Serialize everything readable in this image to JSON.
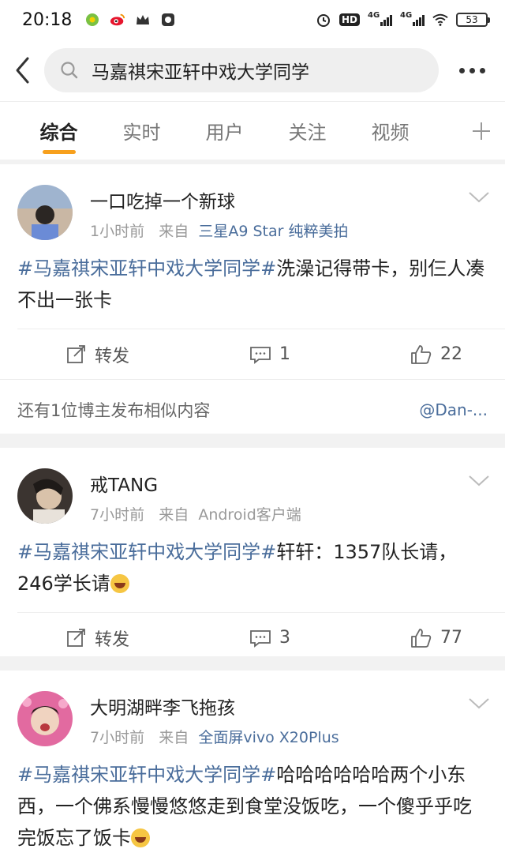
{
  "status_bar": {
    "time": "20:18",
    "battery": "53",
    "network_1": "4G",
    "network_2": "4G",
    "hd_label": "HD"
  },
  "search": {
    "query": "马嘉祺宋亚轩中戏大学同学"
  },
  "tabs": [
    {
      "label": "综合",
      "active": true
    },
    {
      "label": "实时",
      "active": false
    },
    {
      "label": "用户",
      "active": false
    },
    {
      "label": "关注",
      "active": false
    },
    {
      "label": "视频",
      "active": false
    }
  ],
  "posts": [
    {
      "username": "一口吃掉一个新球",
      "time": "1小时前",
      "from_label": "来自",
      "source": "三星A9 Star 纯粹美拍",
      "hashtag": "#马嘉祺宋亚轩中戏大学同学#",
      "text": "洗澡记得带卡，别仨人凑不出一张卡",
      "repost_label": "转发",
      "comments": "1",
      "likes": "22",
      "similar_text": "还有1位博主发布相似内容",
      "similar_user": "@Dan-..."
    },
    {
      "username": "戒TANG",
      "time": "7小时前",
      "from_label": "来自",
      "source": "Android客户端",
      "hashtag": "#马嘉祺宋亚轩中戏大学同学#",
      "text": "轩轩：1357队长请，246学长请",
      "repost_label": "转发",
      "comments": "3",
      "likes": "77"
    },
    {
      "username": "大明湖畔李飞拖孩",
      "time": "7小时前",
      "from_label": "来自",
      "source": "全面屏vivo X20Plus",
      "hashtag": "#马嘉祺宋亚轩中戏大学同学#",
      "text": "哈哈哈哈哈哈两个小东西，一个佛系慢慢悠悠走到食堂没饭吃，一个傻乎乎吃完饭忘了饭卡"
    }
  ],
  "colors": {
    "accent": "#f7a01d",
    "link": "#4a6d9b"
  }
}
